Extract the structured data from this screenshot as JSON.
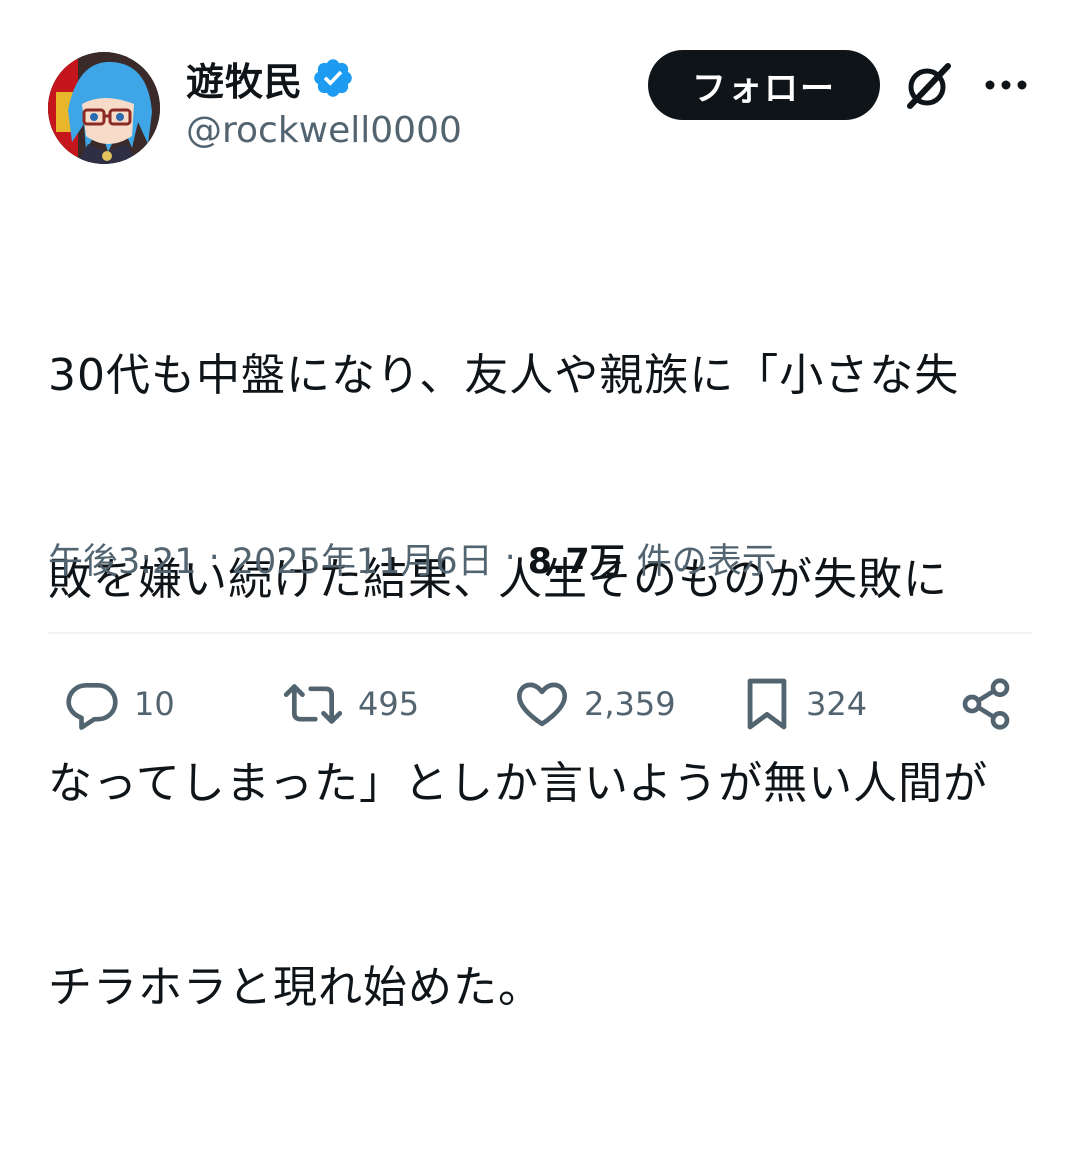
{
  "user": {
    "display_name": "遊牧民",
    "handle": "@rockwell0000",
    "verified": true,
    "avatar_icon": "anime-avatar-blue-hair-glasses"
  },
  "header": {
    "follow_label": "フォロー",
    "grok_icon": "grok-icon",
    "more_icon": "more-icon"
  },
  "tweet": {
    "text": "30代も中盤になり、友人や親族に「小さな失敗を嫌い続けた結果、人生そのものが失敗になってしまった」としか言いようが無い人間がチラホラと現れ始めた。",
    "lines": [
      "30代も中盤になり、友人や親族に「小さな失",
      "敗を嫌い続けた結果、人生そのものが失敗に",
      "なってしまった」としか言いようが無い人間が",
      "チラホラと現れ始めた。"
    ]
  },
  "meta": {
    "time": "午後3:21",
    "separator": "·",
    "date": "2025年11月6日",
    "views_count": "8.7万",
    "views_label": "件の表示"
  },
  "actions": {
    "reply_count": "10",
    "retweet_count": "495",
    "like_count": "2,359",
    "bookmark_count": "324"
  },
  "colors": {
    "text": "#0f1419",
    "secondary": "#536471",
    "verified": "#1d9bf0",
    "follow_bg": "#0f1419",
    "divider": "#eff3f4"
  }
}
